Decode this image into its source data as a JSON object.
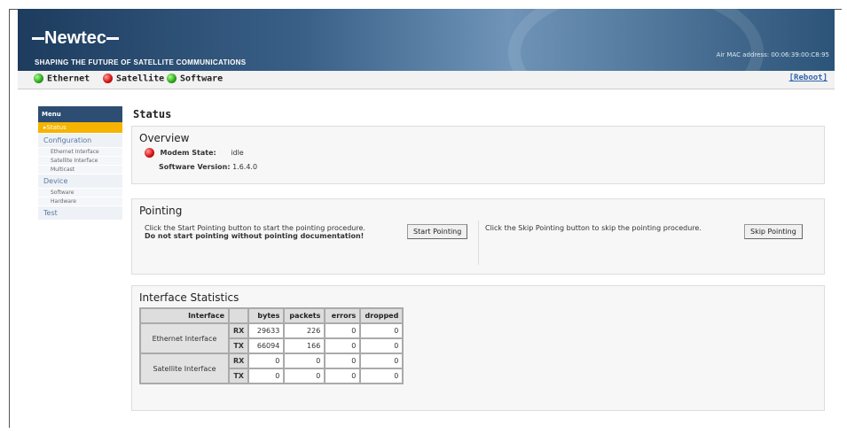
{
  "banner": {
    "logo": "Newtec",
    "slogan": "SHAPING THE FUTURE OF SATELLITE COMMUNICATIONS",
    "mac_label": "Air MAC address:",
    "mac_value": "00:06:39:00:C8:95"
  },
  "statusbar": {
    "items": [
      {
        "label": "Ethernet",
        "status": "green"
      },
      {
        "label": "Satellite",
        "status": "red"
      },
      {
        "label": "Software",
        "status": "green"
      }
    ],
    "reboot": "[Reboot]"
  },
  "sidebar": {
    "header": "Menu",
    "status": "Status",
    "configuration": "Configuration",
    "ethernet_interface": "Ethernet Interface",
    "satellite_interface": "Satellite Interface",
    "multicast": "Multicast",
    "device": "Device",
    "software": "Software",
    "hardware": "Hardware",
    "test": "Test"
  },
  "page": {
    "title": "Status"
  },
  "overview": {
    "title": "Overview",
    "modem_state_label": "Modem State:",
    "modem_state_value": "idle",
    "software_version_label": "Software Version:",
    "software_version_value": "1.6.4.0"
  },
  "pointing": {
    "title": "Pointing",
    "start_text": "Click the Start Pointing button to start the pointing procedure.",
    "warning": "Do not start pointing without pointing documentation!",
    "start_button": "Start Pointing",
    "skip_text": "Click the Skip Pointing button to skip the pointing procedure.",
    "skip_button": "Skip Pointing"
  },
  "stats": {
    "title": "Interface Statistics",
    "headers": [
      "Interface",
      "",
      "bytes",
      "packets",
      "errors",
      "dropped"
    ],
    "ethernet_label": "Ethernet Interface",
    "satellite_label": "Satellite Interface",
    "rows": [
      {
        "dir": "RX",
        "bytes": "29633",
        "packets": "226",
        "errors": "0",
        "dropped": "0"
      },
      {
        "dir": "TX",
        "bytes": "66094",
        "packets": "166",
        "errors": "0",
        "dropped": "0"
      },
      {
        "dir": "RX",
        "bytes": "0",
        "packets": "0",
        "errors": "0",
        "dropped": "0"
      },
      {
        "dir": "TX",
        "bytes": "0",
        "packets": "0",
        "errors": "0",
        "dropped": "0"
      }
    ]
  }
}
